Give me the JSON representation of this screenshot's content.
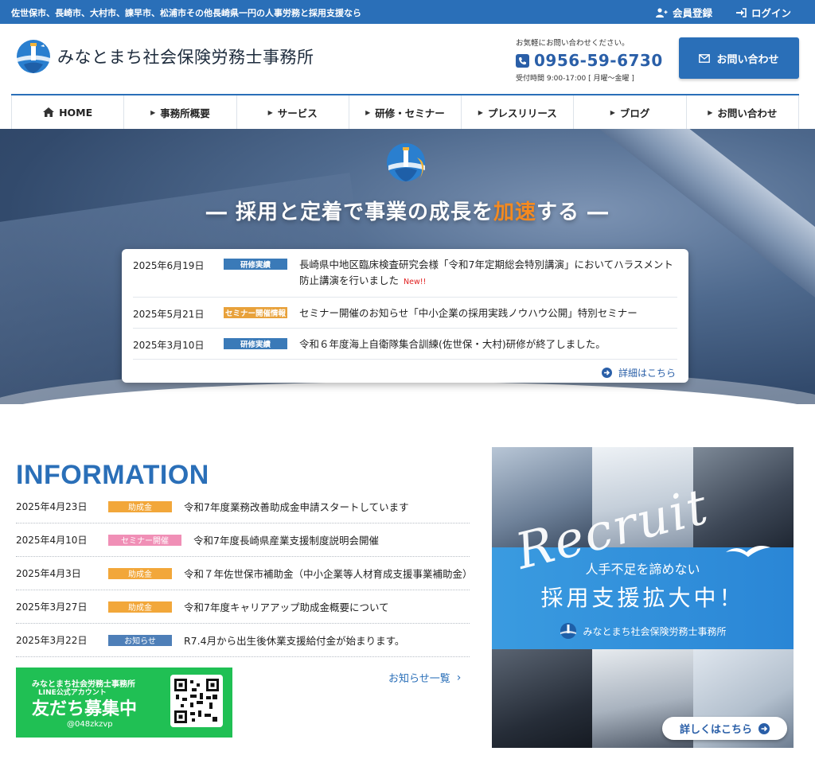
{
  "topbar": {
    "tagline": "佐世保市、長崎市、大村市、諫早市、松浦市その他長崎県一円の人事労務と採用支援なら",
    "member_register": "会員登録",
    "login": "ログイン"
  },
  "header": {
    "site_title": "みなとまち社会保険労務士事務所",
    "contact_note": "お気軽にお問い合わせください。",
    "phone": "0956-59-6730",
    "hours": "受付時間 9:00-17:00 [ 月曜～金曜 ]",
    "inquiry_button": "お問い合わせ"
  },
  "nav": {
    "home": "HOME",
    "about": "事務所概要",
    "services": "サービス",
    "training": "研修・セミナー",
    "press": "プレスリリース",
    "blog": "ブログ",
    "contact": "お問い合わせ"
  },
  "hero": {
    "slogan_before": "― 採用と定着で事業の成長を",
    "slogan_accent": "加速",
    "slogan_after": "する ―",
    "news": [
      {
        "date": "2025年6月19日",
        "badge": "研修実績",
        "badge_color": "#3a7ab8",
        "title": "長崎県中地区臨床検査研究会様「令和7年定期総会特別講演」においてハラスメント防止講演を行いました",
        "new_label": "New!!"
      },
      {
        "date": "2025年5月21日",
        "badge": "セミナー開催情報",
        "badge_color": "#e8a13a",
        "title": "セミナー開催のお知らせ「中小企業の採用実践ノウハウ公開」特別セミナー"
      },
      {
        "date": "2025年3月10日",
        "badge": "研修実績",
        "badge_color": "#3a7ab8",
        "title": "令和６年度海上自衛隊集合訓練(佐世保・大村)研修が終了しました。"
      }
    ],
    "more_label": "詳細はこちら"
  },
  "information": {
    "heading": "INFORMATION",
    "items": [
      {
        "date": "2025年4月23日",
        "badge": "助成金",
        "badge_color": "#f2a73a",
        "title": "令和7年度業務改善助成金申請スタートしています"
      },
      {
        "date": "2025年4月10日",
        "badge": "セミナー開催",
        "badge_color": "#f08fb6",
        "title": "令和7年度長崎県産業支援制度説明会開催"
      },
      {
        "date": "2025年4月3日",
        "badge": "助成金",
        "badge_color": "#f2a73a",
        "title": "令和７年佐世保市補助金（中小企業等人材育成支援事業補助金）"
      },
      {
        "date": "2025年3月27日",
        "badge": "助成金",
        "badge_color": "#f2a73a",
        "title": "令和7年度キャリアアップ助成金概要について"
      },
      {
        "date": "2025年3月22日",
        "badge": "お知らせ",
        "badge_color": "#4e7fb8",
        "title": "R7.4月から出生後休業支援給付金が始まります。"
      }
    ],
    "more_label": "お知らせ一覧"
  },
  "line_banner": {
    "line1": "みなとまち社会労務士事務所",
    "line2": "LINE公式アカウント",
    "line3": "友だち募集中",
    "line_id": "@048zkzvp"
  },
  "recruit": {
    "script_word": "Recruit",
    "tagline": "人手不足を諦めない",
    "headline": "採用支援拡大中！",
    "org": "みなとまち社会保険労務士事務所",
    "button": "詳しくはこちら"
  },
  "colors": {
    "primary": "#2a6fb8",
    "accent": "#f58a1f",
    "line_green": "#20c054"
  }
}
